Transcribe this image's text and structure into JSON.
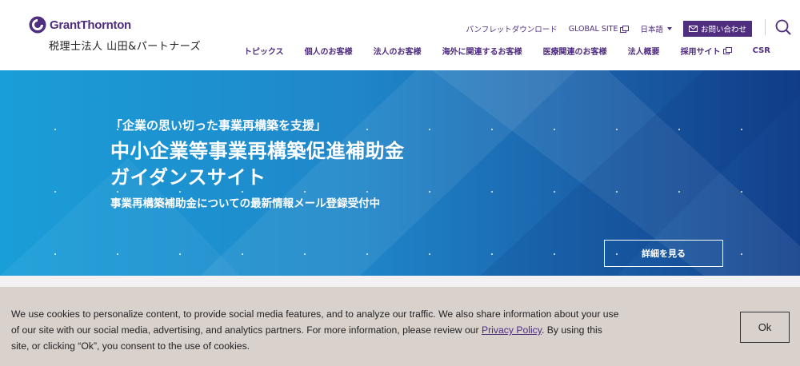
{
  "brand": {
    "name": "GrantThornton",
    "subtitle": "税理士法人 山田&パートナーズ",
    "logo_icon": "grant-thornton-logo-icon",
    "color": "#4f2d7f"
  },
  "utility_nav": {
    "pamphlet": "パンフレットダウンロード",
    "global_site": "GLOBAL SITE",
    "language": "日本語",
    "contact": "お問い合わせ"
  },
  "main_nav": [
    {
      "label": "トピックス"
    },
    {
      "label": "個人のお客様"
    },
    {
      "label": "法人のお客様"
    },
    {
      "label": "海外に関連するお客様"
    },
    {
      "label": "医療関連のお客様"
    },
    {
      "label": "法人概要"
    },
    {
      "label": "採用サイト"
    },
    {
      "label": "CSR"
    }
  ],
  "hero": {
    "tagline": "「企業の思い切った事業再構築を支援」",
    "title_line1": "中小企業等事業再構築促進補助金",
    "title_line2": "ガイダンスサイト",
    "description": "事業再構築補助金についての最新情報メール登録受付中",
    "button": "詳細を見る",
    "colors": {
      "start": "#1a9ed8",
      "end": "#123f8a"
    }
  },
  "cookie_banner": {
    "text_before_link": "We use cookies to personalize content, to provide social media features, and to analyze our traffic. We also share information about your use of our site with our social media, advertising, and analytics partners. For more information, please review our ",
    "link_text": "Privacy Policy",
    "text_after_link": ". By using this site, or clicking “Ok”, you consent to the use of cookies.",
    "ok_button": "Ok"
  }
}
